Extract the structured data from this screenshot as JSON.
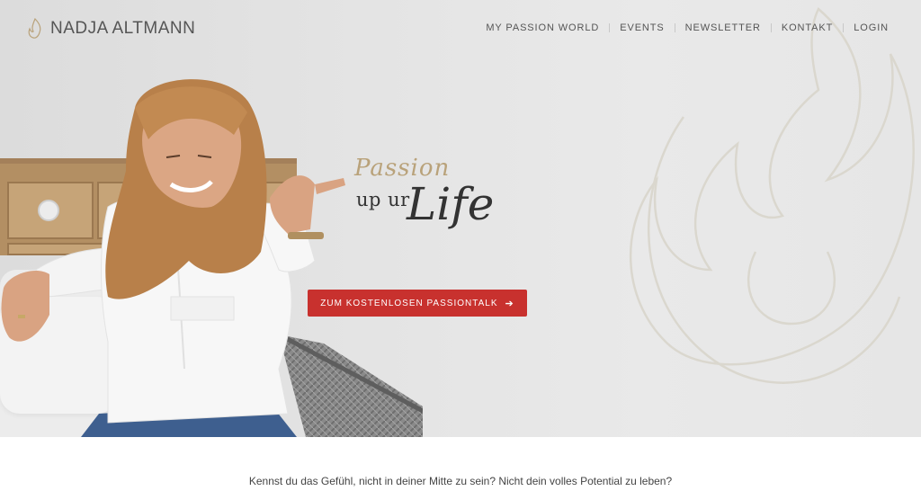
{
  "brand": {
    "name": "NADJA ALTMANN",
    "logo_icon": "flame-icon",
    "accent_color": "#c8312e",
    "gold_color": "#b9a27a"
  },
  "nav": {
    "items": [
      {
        "label": "MY PASSION WORLD"
      },
      {
        "label": "EVENTS"
      },
      {
        "label": "NEWSLETTER"
      },
      {
        "label": "KONTAKT"
      },
      {
        "label": "LOGIN"
      }
    ]
  },
  "hero": {
    "tagline_passion": "Passion",
    "tagline_upur": "up ur",
    "tagline_life": "Life",
    "cta_label": "ZUM KOSTENLOSEN PASSIONTALK",
    "cta_icon": "arrow-right-icon"
  },
  "content": {
    "intro": "Kennst du das Gefühl, nicht in deiner Mitte zu sein? Nicht dein volles Potential zu leben?"
  }
}
